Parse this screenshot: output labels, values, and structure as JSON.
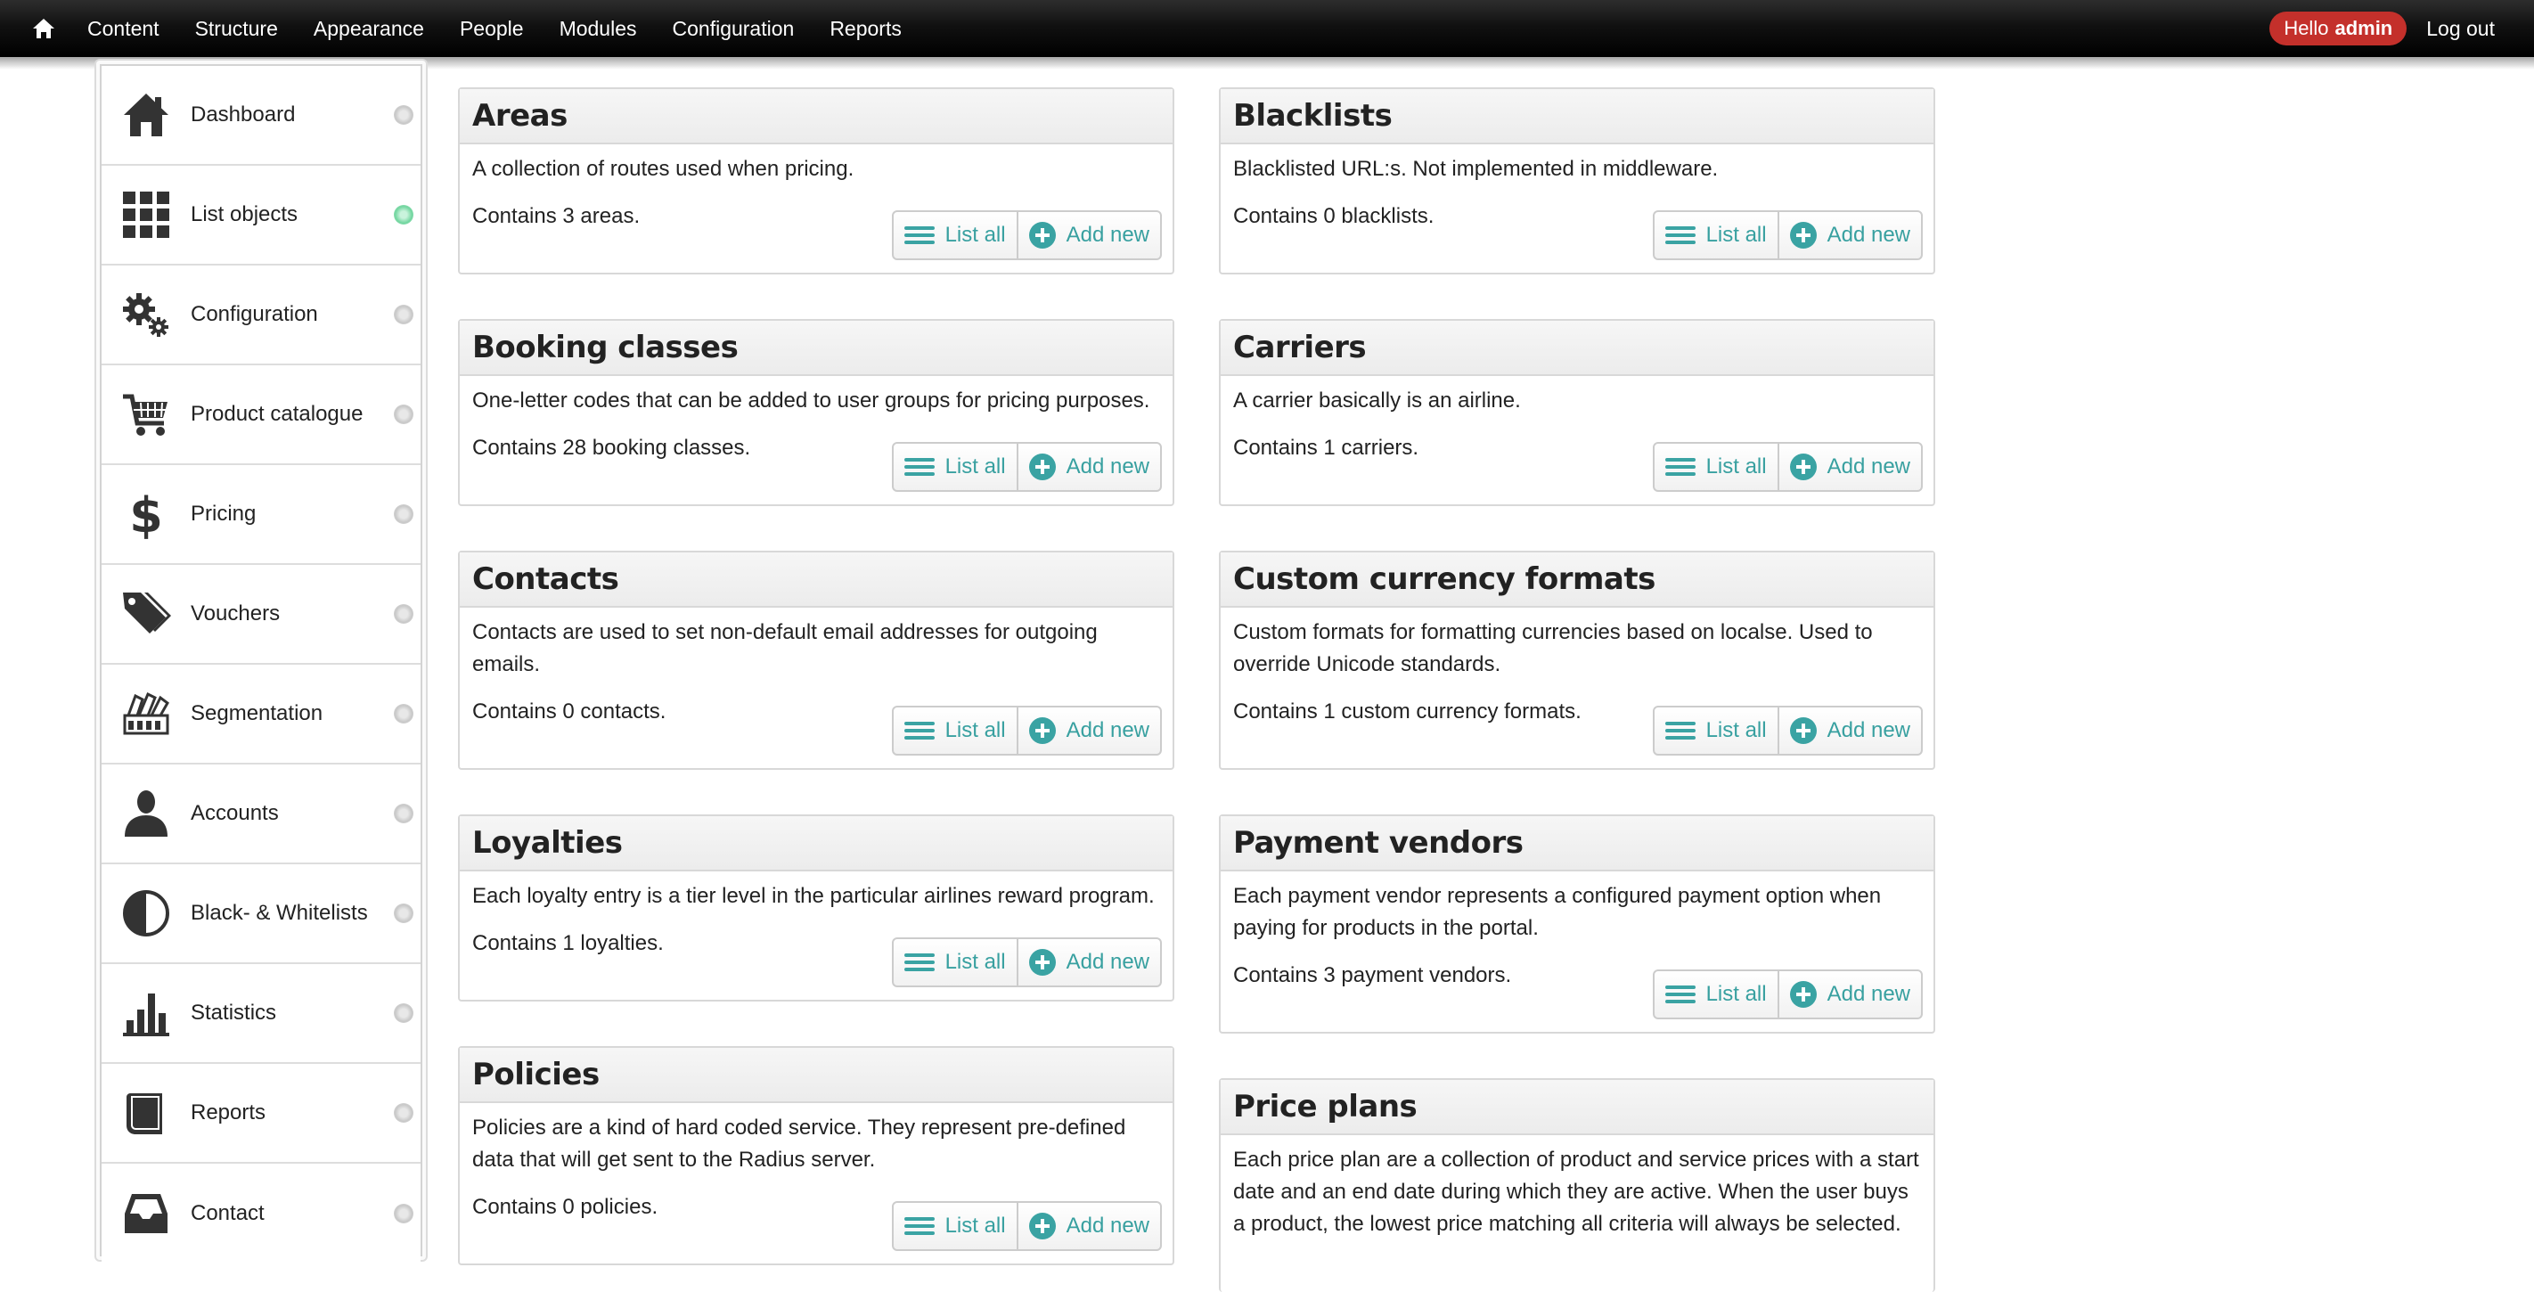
{
  "toolbar": {
    "home_icon": "home-icon",
    "menu": [
      "Content",
      "Structure",
      "Appearance",
      "People",
      "Modules",
      "Configuration",
      "Reports"
    ],
    "hello_text": "Hello",
    "username": "admin",
    "logout": "Log out"
  },
  "sidebar": {
    "items": [
      {
        "label": "Dashboard",
        "icon": "house-icon",
        "active": false
      },
      {
        "label": "List objects",
        "icon": "grid-icon",
        "active": true
      },
      {
        "label": "Configuration",
        "icon": "gears-icon",
        "active": false
      },
      {
        "label": "Product catalogue",
        "icon": "cart-icon",
        "active": false
      },
      {
        "label": "Pricing",
        "icon": "dollar-icon",
        "active": false
      },
      {
        "label": "Vouchers",
        "icon": "tags-icon",
        "active": false
      },
      {
        "label": "Segmentation",
        "icon": "swatches-icon",
        "active": false
      },
      {
        "label": "Accounts",
        "icon": "user-icon",
        "active": false
      },
      {
        "label": "Black- & Whitelists",
        "icon": "contrast-icon",
        "active": false
      },
      {
        "label": "Statistics",
        "icon": "bar-chart-icon",
        "active": false
      },
      {
        "label": "Reports",
        "icon": "book-icon",
        "active": false
      },
      {
        "label": "Contact",
        "icon": "inbox-icon",
        "active": false
      }
    ]
  },
  "actions": {
    "list_all": "List all",
    "add_new": "Add new"
  },
  "cards": {
    "areas": {
      "title": "Areas",
      "description": "A collection of routes used when pricing.",
      "count": "Contains 3 areas."
    },
    "blacklists": {
      "title": "Blacklists",
      "description": "Blacklisted URL:s. Not implemented in middleware.",
      "count": "Contains 0 blacklists."
    },
    "booking_classes": {
      "title": "Booking classes",
      "description": "One-letter codes that can be added to user groups for pricing purposes.",
      "count": "Contains 28 booking classes."
    },
    "carriers": {
      "title": "Carriers",
      "description": "A carrier basically is an airline.",
      "count": "Contains 1 carriers."
    },
    "contacts": {
      "title": "Contacts",
      "description": "Contacts are used to set non-default email addresses for outgoing emails.",
      "count": "Contains 0 contacts."
    },
    "custom_currency_formats": {
      "title": "Custom currency formats",
      "description": "Custom formats for formatting currencies based on localse. Used to override Unicode standards.",
      "count": "Contains 1 custom currency formats."
    },
    "loyalties": {
      "title": "Loyalties",
      "description": "Each loyalty entry is a tier level in the particular airlines reward program.",
      "count": "Contains 1 loyalties."
    },
    "payment_vendors": {
      "title": "Payment vendors",
      "description": "Each payment vendor represents a configured payment option when paying for products in the portal.",
      "count": "Contains 3 payment vendors."
    },
    "policies": {
      "title": "Policies",
      "description": "Policies are a kind of hard coded service. They represent pre-defined data that will get sent to the Radius server.",
      "count": "Contains 0 policies."
    },
    "price_plans": {
      "title": "Price plans",
      "description": "Each price plan are a collection of product and service prices with a start date and an end date during which they are active. When the user buys a product, the lowest price matching all criteria will always be selected."
    }
  }
}
